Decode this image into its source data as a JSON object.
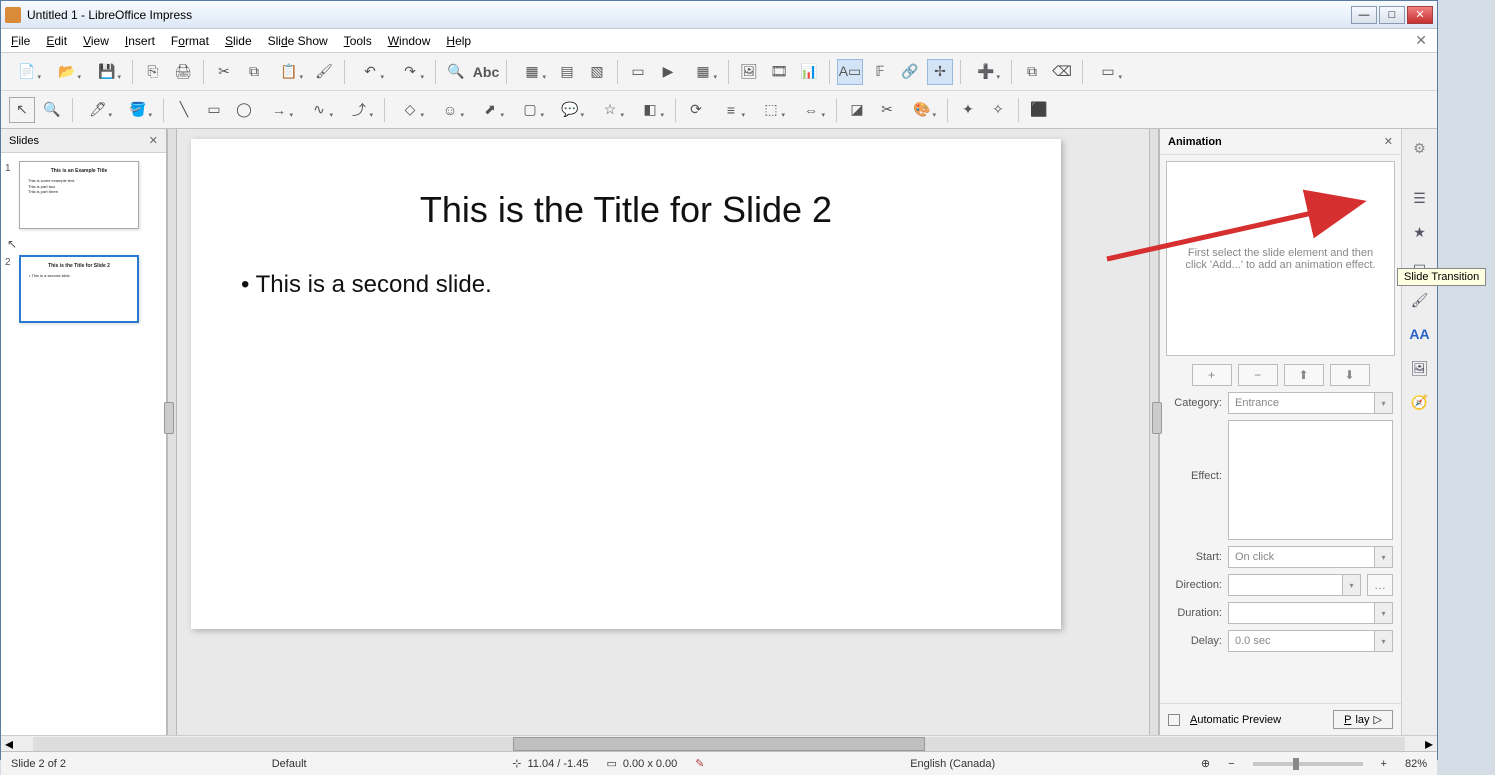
{
  "window": {
    "title": "Untitled 1 - LibreOffice Impress"
  },
  "menu": {
    "file": "File",
    "edit": "Edit",
    "view": "View",
    "insert": "Insert",
    "format": "Format",
    "slide": "Slide",
    "slideshow": "Slide Show",
    "tools": "Tools",
    "window": "Window",
    "help": "Help"
  },
  "slides_panel": {
    "title": "Slides"
  },
  "thumbs": [
    {
      "num": "1",
      "title": "This is an Example Title",
      "bullets": [
        "This is some example text.",
        "  This is part two.",
        "  This is part three."
      ]
    },
    {
      "num": "2",
      "title": "This is the Title for Slide 2",
      "bullets": [
        "This is a second slide."
      ]
    }
  ],
  "canvas": {
    "title": "This is the Title for Slide 2",
    "bullet": "This is a second slide."
  },
  "anim": {
    "title": "Animation",
    "hint": "First select the slide element and then click 'Add...' to add an animation effect.",
    "category_label": "Category:",
    "category_value": "Entrance",
    "effect_label": "Effect:",
    "start_label": "Start:",
    "start_value": "On click",
    "direction_label": "Direction:",
    "duration_label": "Duration:",
    "delay_label": "Delay:",
    "delay_value": "0.0 sec",
    "auto_preview": "Automatic Preview",
    "play": "Play"
  },
  "tooltip": "Slide Transition",
  "status": {
    "slide": "Slide 2 of 2",
    "master": "Default",
    "cursor": "11.04 / -1.45",
    "size": "0.00 x 0.00",
    "lang": "English (Canada)",
    "zoom": "82%"
  }
}
